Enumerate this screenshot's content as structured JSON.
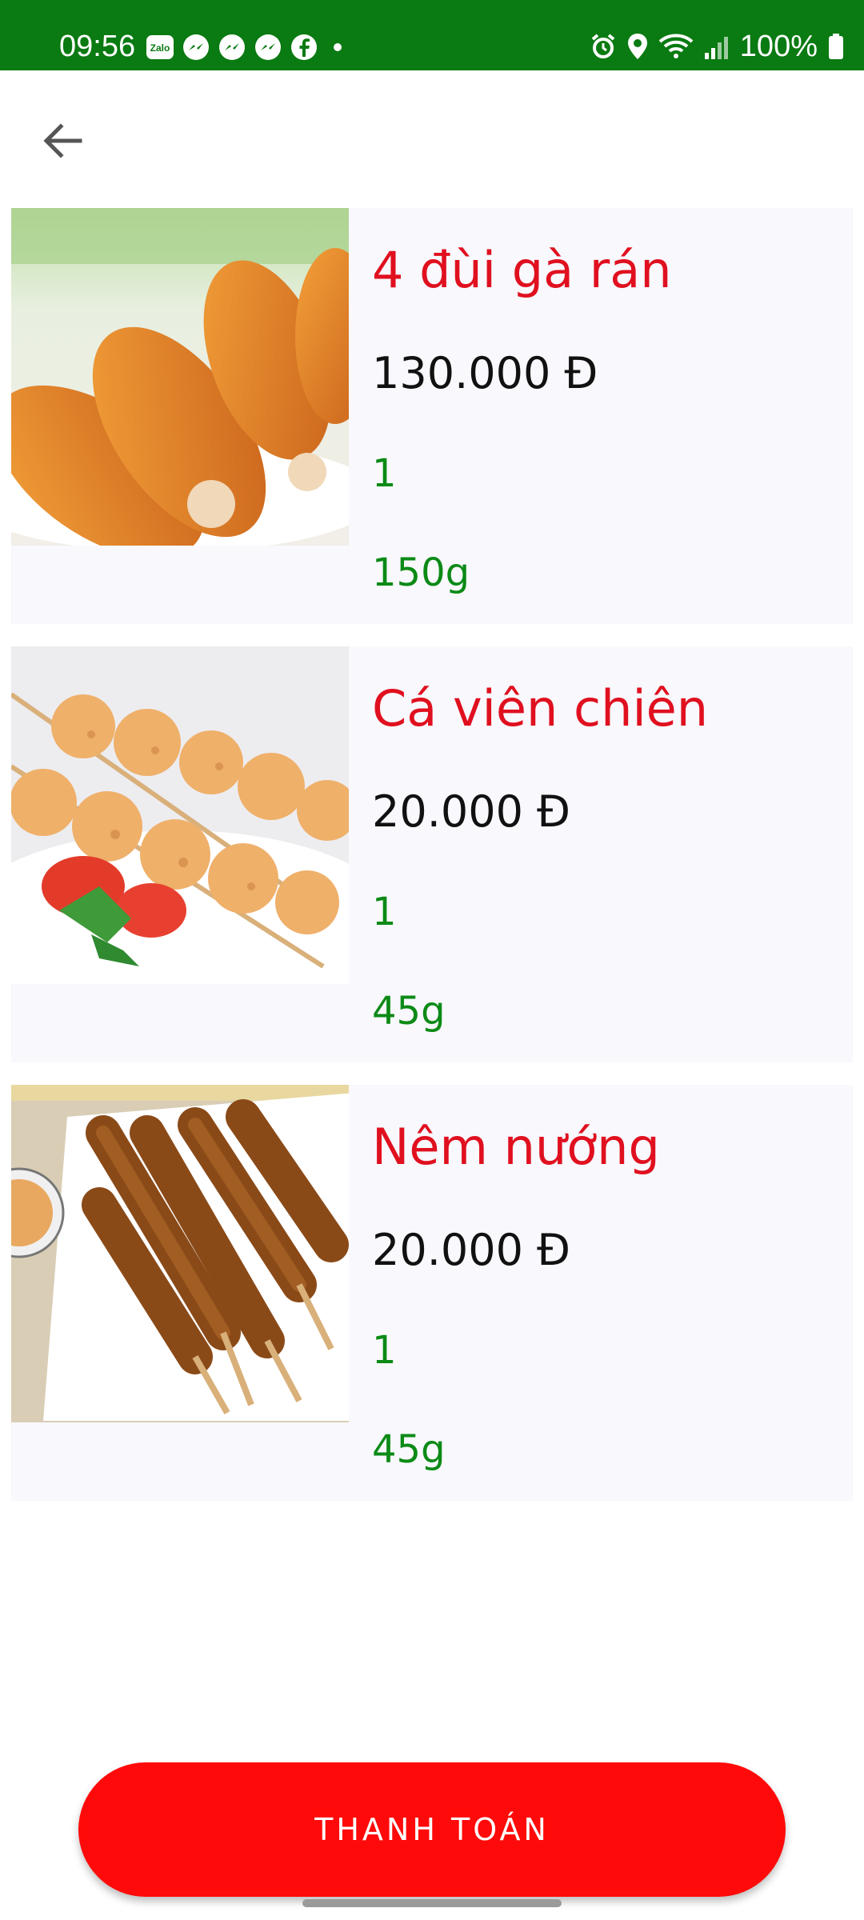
{
  "status_bar": {
    "time": "09:56",
    "battery": "100%",
    "left_icons": [
      "zalo-icon",
      "messenger-icon",
      "messenger-icon",
      "messenger-icon",
      "facebook-icon",
      "dot-icon"
    ],
    "right_icons": [
      "alarm-icon",
      "location-icon",
      "wifi-icon",
      "signal-icon",
      "battery-icon"
    ],
    "background_color": "#0a7a12"
  },
  "toolbar": {
    "back_icon": "arrow-back-icon"
  },
  "cart": {
    "items": [
      {
        "name": "4 đùi gà rán",
        "price": "130.000 Đ",
        "quantity": "1",
        "weight": "150g",
        "image": "fried-chicken-image"
      },
      {
        "name": "Cá viên chiên",
        "price": "20.000 Đ",
        "quantity": "1",
        "weight": "45g",
        "image": "fried-fishball-image"
      },
      {
        "name": "Nêm nướng",
        "price": "20.000 Đ",
        "quantity": "1",
        "weight": "45g",
        "image": "grilled-nem-image"
      }
    ]
  },
  "checkout": {
    "label": "THANH TOÁN",
    "color": "#ff0a0a"
  },
  "colors": {
    "name": "#e0101f",
    "price": "#111111",
    "detail": "#0c8a16",
    "item_background": "#f8f8fd"
  }
}
